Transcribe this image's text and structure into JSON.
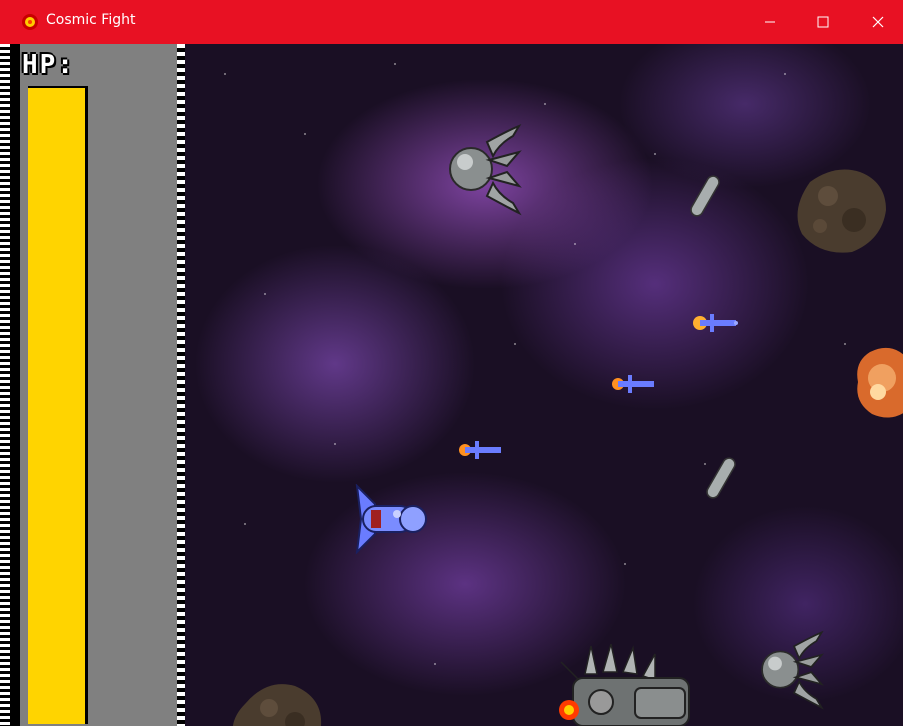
{
  "window": {
    "title": "Cosmic Fight",
    "controls": {
      "minimize": "—",
      "maximize": "☐",
      "close": "✕"
    },
    "titlebar_color": "#e81123"
  },
  "hud": {
    "hp_label": "HP:",
    "hp_fraction": 1.0,
    "hp_color": "#ffd400",
    "panel_color": "#808080"
  },
  "icons": [
    "app-bomb-icon",
    "minimize-icon",
    "maximize-icon",
    "close-icon"
  ],
  "scene": {
    "background": "purple nebula starfield",
    "objects": [
      "player-ship",
      "enemy-claw-ship",
      "enemy-claw-ship",
      "enemy-spiked-boss",
      "asteroid",
      "asteroid",
      "explosion",
      "bullet",
      "bullet",
      "bullet",
      "enemy-capsule",
      "enemy-capsule"
    ]
  }
}
